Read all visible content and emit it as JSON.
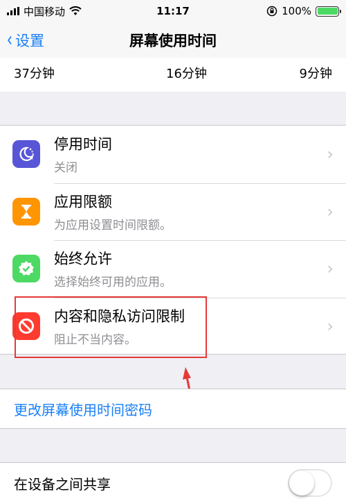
{
  "status_bar": {
    "carrier": "中国移动",
    "time": "11:17",
    "battery": "100%",
    "battery_level": 1.0
  },
  "nav": {
    "back_label": "设置",
    "title": "屏幕使用时间"
  },
  "usage": [
    "37分钟",
    "16分钟",
    "9分钟"
  ],
  "settings": [
    {
      "title": "停用时间",
      "subtitle": "关闭",
      "icon": "downtime-moon-icon",
      "color": "#5856d6"
    },
    {
      "title": "应用限额",
      "subtitle": "为应用设置时间限额。",
      "icon": "hourglass-icon",
      "color": "#ff9500"
    },
    {
      "title": "始终允许",
      "subtitle": "选择始终可用的应用。",
      "icon": "checkmark-badge-icon",
      "color": "#4cd964"
    },
    {
      "title": "内容和隐私访问限制",
      "subtitle": "阻止不当内容。",
      "icon": "no-entry-icon",
      "color": "#ff3b30"
    }
  ],
  "passcode_link": "更改屏幕使用时间密码",
  "share": {
    "label": "在设备之间共享",
    "enabled": false
  },
  "annotation_color": "#e53939"
}
